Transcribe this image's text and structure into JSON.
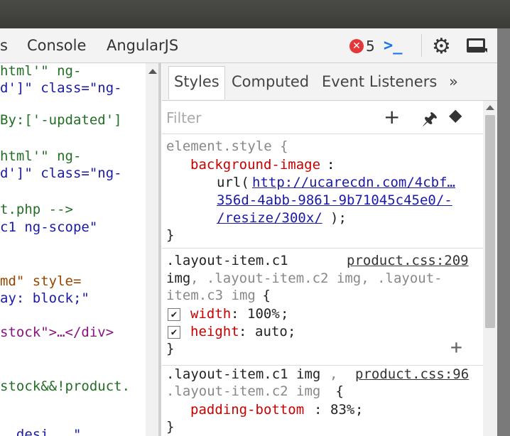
{
  "toolbar": {
    "tab_partial": "s",
    "tab_console": "Console",
    "tab_angular": "AngularJS",
    "error_icon": "✕",
    "error_count": "5",
    "prompt_glyph": ">_"
  },
  "elements_panel": {
    "lines": [
      "html'\" ng-",
      "d']\" class=\"ng-",
      "By:['-updated']",
      "html'\" ng-",
      "d']\" class=\"ng-",
      "t.php -->",
      "c1 ng-scope\"",
      "md\" style=",
      "ay: block;\"",
      "stock\">…</div>",
      "stock&&!product.",
      "  desi   \""
    ]
  },
  "styles": {
    "tabs": [
      "Styles",
      "Computed",
      "Event Listeners",
      "»"
    ],
    "filter_placeholder": "Filter",
    "element_style": {
      "selector": "element.style {",
      "prop": "background-image",
      "url_prefix": "url(",
      "url1": "http://ucarecdn.com/4cbf…",
      "url2": "356d-4abb-9861-9b71045c45e0/-",
      "url3": "/resize/300x/",
      "url_suffix": ");",
      "close": "}"
    },
    "rule1": {
      "sel1": ".layout-item.c1",
      "source": "product.css:209",
      "sel2a": "img",
      "sel2b": ", .layout-item.c2 img, .layout-",
      "sel3a": "item.c3 img",
      "sel3b": " {",
      "props": [
        {
          "name": "width",
          "value": "100%"
        },
        {
          "name": "height",
          "value": "auto"
        }
      ],
      "close": "}"
    },
    "rule2": {
      "sel1": ".layout-item.c1 img",
      "comma": ",",
      "source": "product.css:96",
      "sel2": ".layout-item.c2 img",
      "brace": " {",
      "prop": "padding-bottom",
      "value": "83%",
      "close": "}"
    }
  }
}
